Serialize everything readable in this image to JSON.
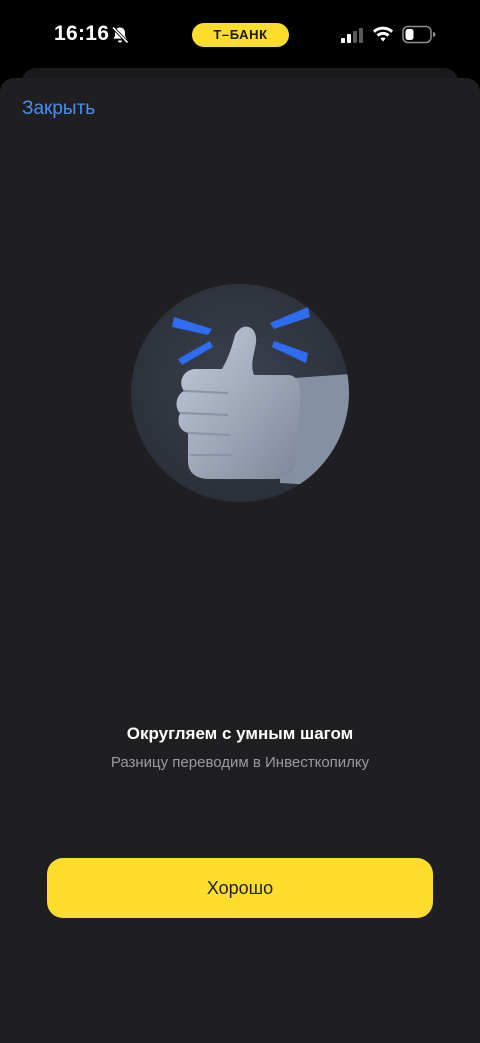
{
  "status_bar": {
    "time": "16:16",
    "carrier_badge": "Т–БАНК",
    "icons": [
      "bell-slash-icon",
      "cellular-signal-icon",
      "wifi-icon",
      "battery-icon"
    ]
  },
  "sheet": {
    "close_label": "Закрыть",
    "illustration_icon": "thumbs-up-icon",
    "title": "Округляем с умным шагом",
    "subtitle": "Разницу переводим в Инвесткопилку",
    "ok_button_label": "Хорошо"
  },
  "colors": {
    "accent_yellow": "#FFDD2D",
    "link_blue": "#4A90F0",
    "sheet_background": "#1F1F21",
    "app_background": "#000000"
  }
}
